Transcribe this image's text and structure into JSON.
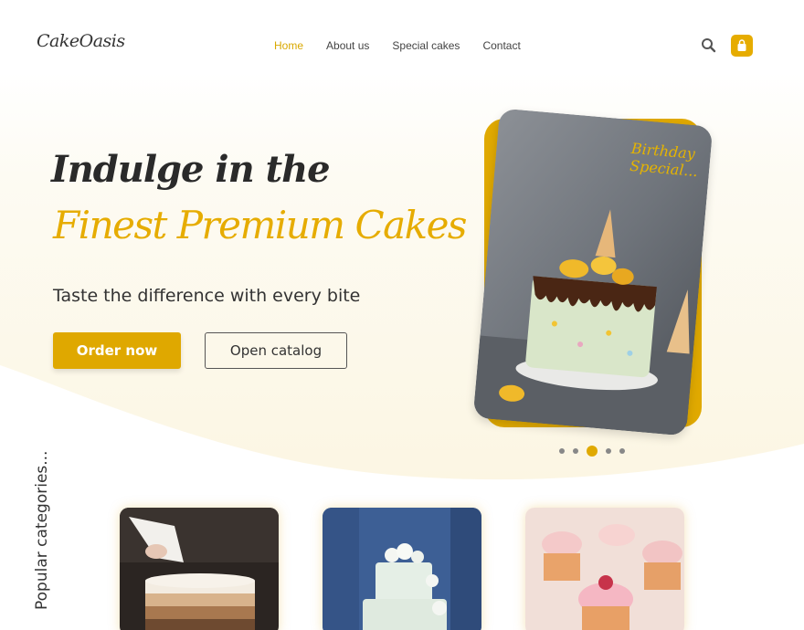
{
  "brand": {
    "logo_text": "CakeOasis",
    "accent_color": "#e0a900"
  },
  "nav": {
    "items": [
      "Home",
      "About us",
      "Special cakes",
      "Contact"
    ],
    "active": "Home"
  },
  "header": {
    "search_icon": "search-icon",
    "cart_icon": "shopping-bag-icon"
  },
  "hero": {
    "headline_line1": "Indulge in the",
    "headline_line2": "Finest Premium Cakes",
    "tagline": "Taste the difference with every bite",
    "order_button": "Order now",
    "catalog_button": "Open catalog",
    "card_label": "Birthday\nSpecial...",
    "carousel": {
      "count": 5,
      "active_index": 2
    }
  },
  "categories": {
    "title": "Popular categories...",
    "items": [
      {
        "image": "piped-ombre-cake"
      },
      {
        "image": "white-tiered-wedding-cake"
      },
      {
        "image": "pink-cupcakes"
      }
    ]
  }
}
